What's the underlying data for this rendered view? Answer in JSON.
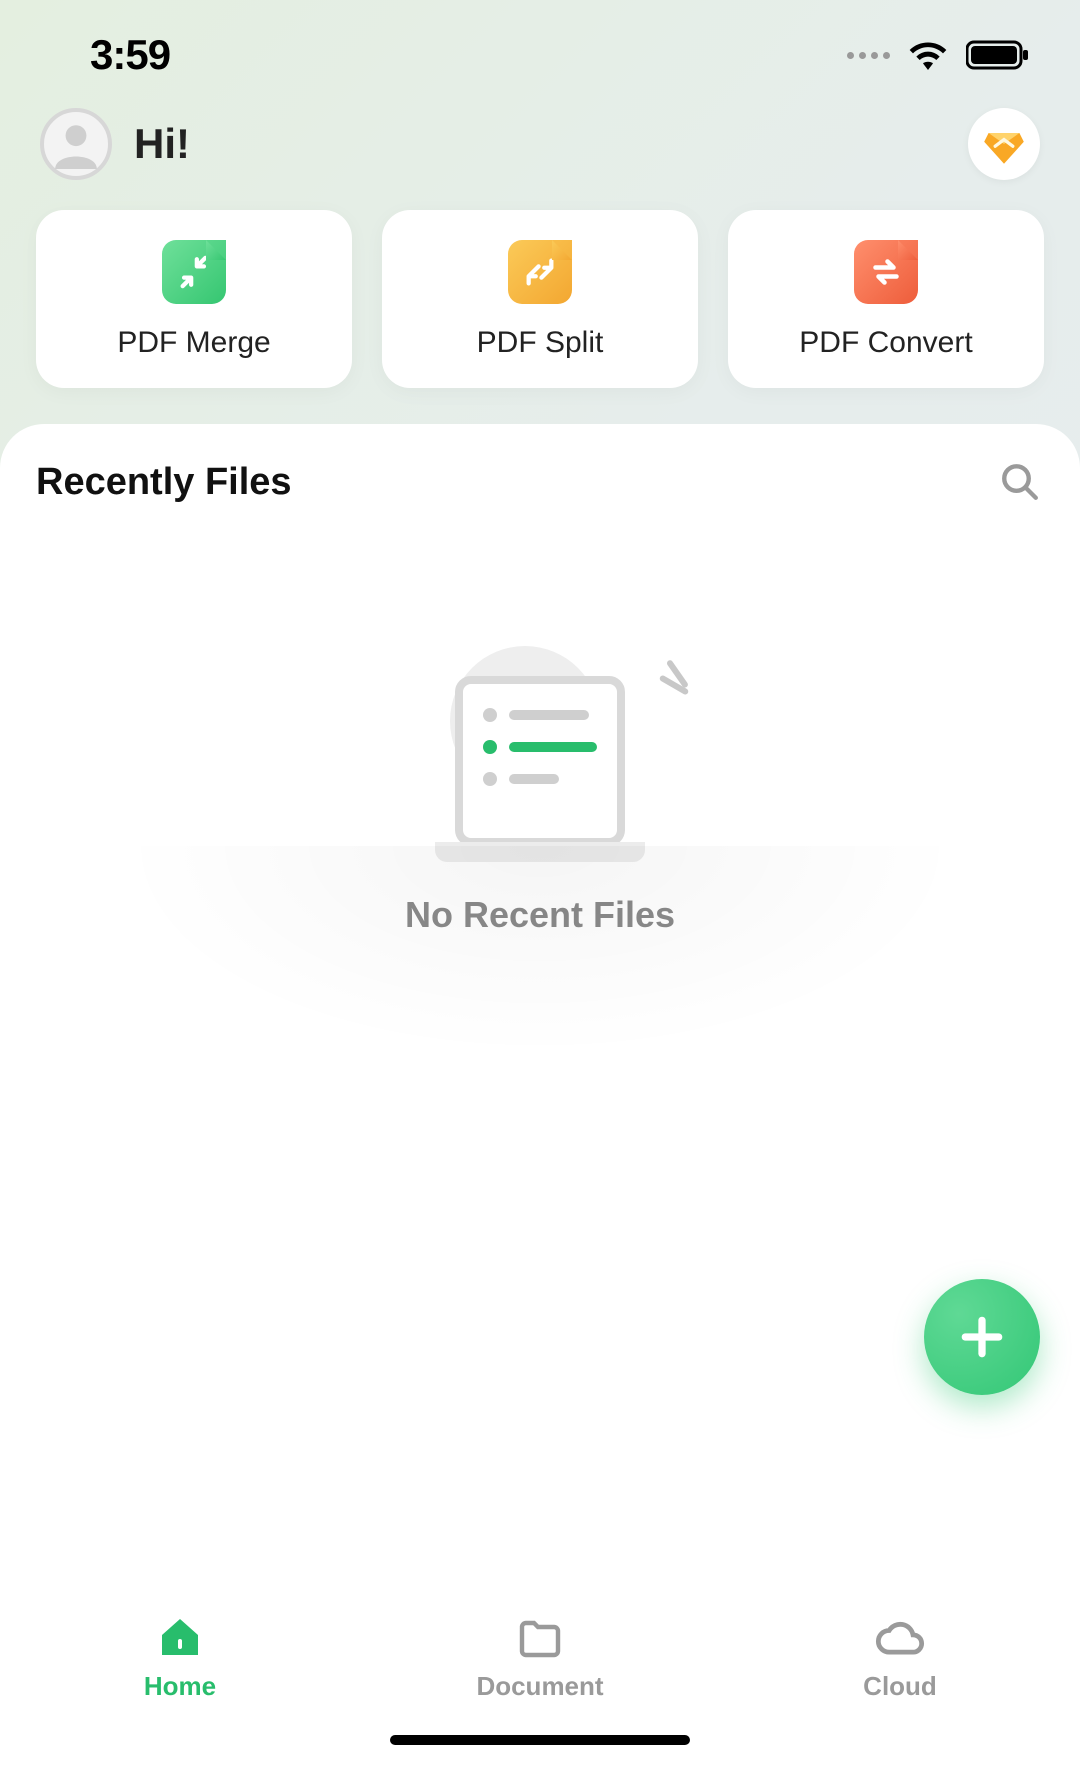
{
  "status": {
    "time": "3:59"
  },
  "header": {
    "greeting": "Hi!"
  },
  "actions": [
    {
      "label": "PDF Merge",
      "icon": "merge",
      "bg": "#4cd07d"
    },
    {
      "label": "PDF Split",
      "icon": "split",
      "bg": "#f7b735"
    },
    {
      "label": "PDF Convert",
      "icon": "convert",
      "bg": "#f2704e"
    }
  ],
  "recent": {
    "title": "Recently Files",
    "empty_text": "No Recent Files"
  },
  "nav": [
    {
      "label": "Home",
      "icon": "home",
      "active": true
    },
    {
      "label": "Document",
      "icon": "document",
      "active": false
    },
    {
      "label": "Cloud",
      "icon": "cloud",
      "active": false
    }
  ]
}
